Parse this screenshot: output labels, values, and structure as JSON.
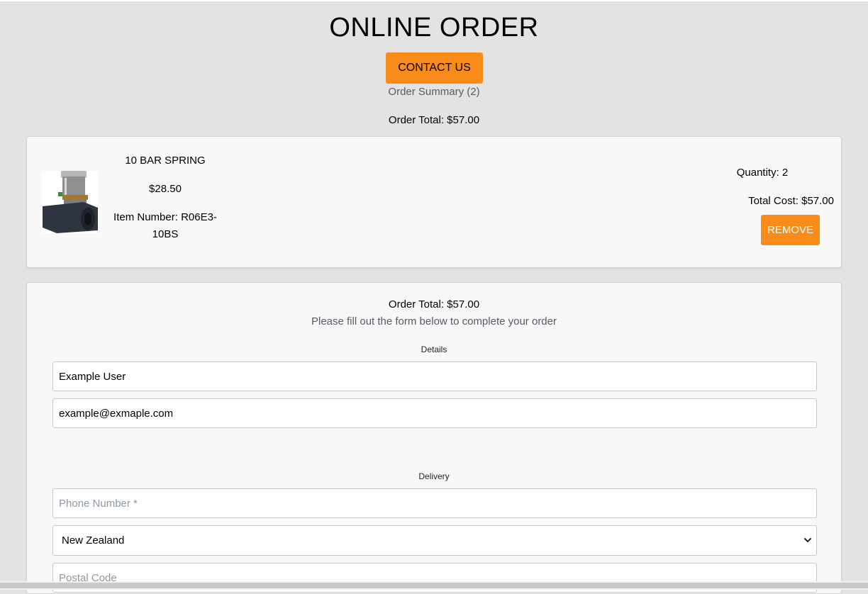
{
  "header": {
    "title": "ONLINE ORDER",
    "contact_label": "CONTACT US",
    "order_summary": "Order Summary (2)",
    "order_total": "Order Total: $57.00"
  },
  "item": {
    "name": "10 BAR SPRING",
    "price": "$28.50",
    "number": "Item Number: R06E3-10BS",
    "quantity": "Quantity: 2",
    "total_cost": "Total Cost: $57.00",
    "remove_label": "REMOVE"
  },
  "form": {
    "order_total": "Order Total: $57.00",
    "instructions": "Please fill out the form below to complete your order",
    "details_label": "Details",
    "name_value": "Example User",
    "email_value": "example@exmaple.com",
    "delivery_label": "Delivery",
    "phone_placeholder": "Phone Number *",
    "country_value": "New Zealand",
    "postal_placeholder": "Postal Code"
  },
  "colors": {
    "accent": "#f98b1a",
    "background": "#e3e3e3",
    "card": "#f8f8f8"
  }
}
